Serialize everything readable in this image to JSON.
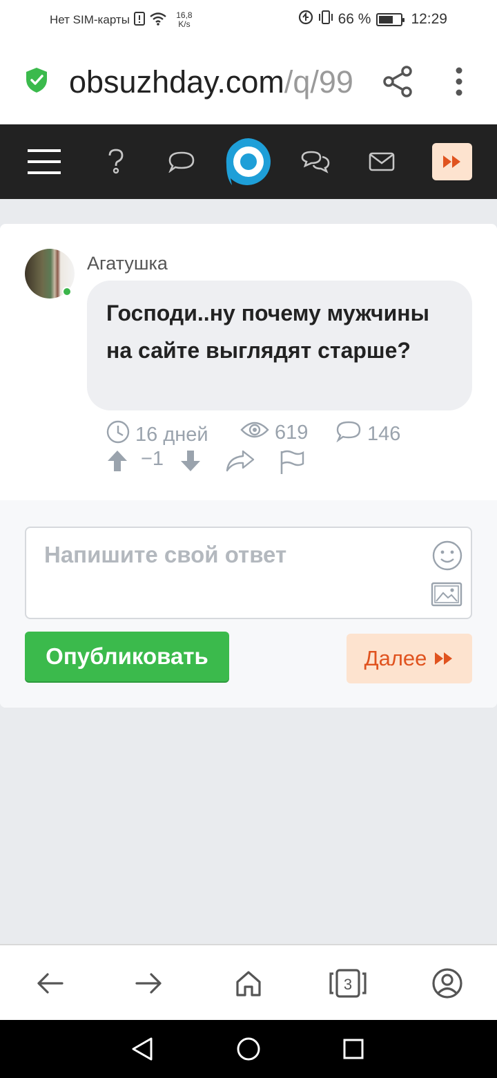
{
  "status_bar": {
    "carrier": "Нет SIM-карты",
    "speed_value": "16,8",
    "speed_unit": "K/s",
    "battery_percent": "66 %",
    "battery_level": 0.66,
    "time": "12:29"
  },
  "browser": {
    "url_domain": "obsuzhday.com",
    "url_path": "/q/99",
    "share_icon": "share-icon",
    "menu_icon": "more-vertical-icon",
    "tab_count": "3"
  },
  "site_nav": {
    "items": [
      "menu-icon",
      "question-icon",
      "comment-icon",
      "logo",
      "discussions-icon",
      "mail-icon",
      "next-icon"
    ]
  },
  "question": {
    "author": "Агатушка",
    "text": "Господи..ну почему мужчины на сайте выглядят старше?",
    "age": "16 дней",
    "views": "619",
    "answers": "146",
    "votes": "−1"
  },
  "answer_form": {
    "placeholder": "Напишите свой ответ",
    "publish_label": "Опубликовать",
    "next_label": "Далее"
  },
  "colors": {
    "accent_green": "#3bba4c",
    "accent_orange": "#e0531f",
    "logo_blue": "#1e9fd8",
    "nav_dark": "#222222"
  }
}
